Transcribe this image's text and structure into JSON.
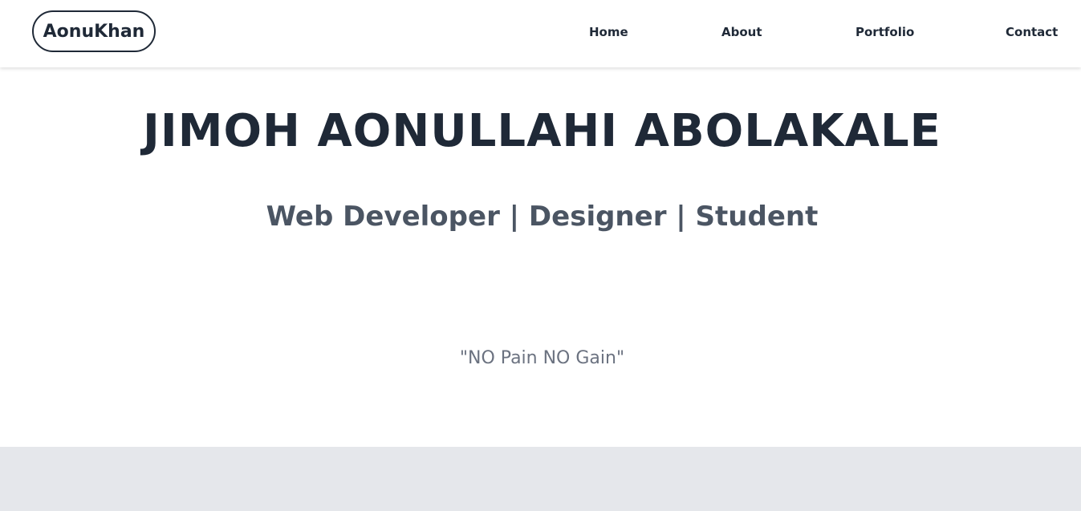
{
  "navbar": {
    "logo_text": "AonuKhan",
    "links": [
      {
        "label": "Home"
      },
      {
        "label": "About"
      },
      {
        "label": "Portfolio"
      },
      {
        "label": "Contact"
      }
    ]
  },
  "hero": {
    "name": "JIMOH AONULLAHI ABOLAKALE",
    "roles": "Web Developer | Designer | Student",
    "quote": "\"NO Pain NO Gain\""
  },
  "colors": {
    "text_dark": "#1f2937",
    "text_medium": "#4b5563",
    "text_light": "#6b7280",
    "section_gray": "#e5e7eb"
  }
}
